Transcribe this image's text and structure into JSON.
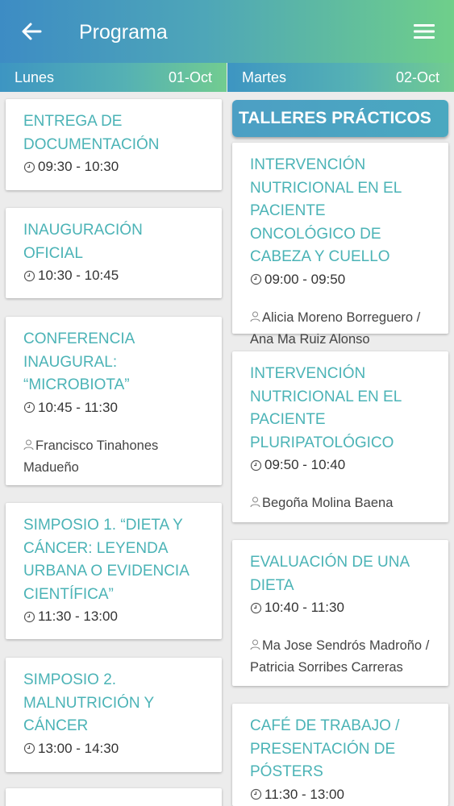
{
  "appbar": {
    "title": "Programa"
  },
  "days": [
    {
      "name": "Lunes",
      "date": "01-Oct",
      "events": [
        {
          "title": "ENTREGA DE DOCUMENTACIÓN",
          "time": "09:30 - 10:30",
          "speaker": ""
        },
        {
          "title": "INAUGURACIÓN OFICIAL",
          "time": "10:30 - 10:45",
          "speaker": ""
        },
        {
          "title": "CONFERENCIA INAUGURAL: “MICROBIOTA”",
          "time": "10:45 - 11:30",
          "speaker": "Francisco Tinahones Madueño"
        },
        {
          "title": "SIMPOSIO 1. “DIETA Y CÁNCER: LEYENDA URBANA O EVIDENCIA CIENTÍFICA”",
          "time": "11:30 - 13:00",
          "speaker": ""
        },
        {
          "title": "SIMPOSIO 2. MALNUTRICIÓN Y CÁNCER",
          "time": "13:00 - 14:30",
          "speaker": ""
        }
      ]
    },
    {
      "name": "Martes",
      "date": "02-Oct",
      "section": "TALLERES PRÁCTICOS",
      "events": [
        {
          "title": "INTERVENCIÓN NUTRICIONAL EN EL PACIENTE ONCOLÓGICO DE CABEZA Y CUELLO",
          "time": "09:00 - 09:50",
          "speaker": "Alicia Moreno Borreguero / Ana Ma Ruiz Alonso"
        },
        {
          "title": "INTERVENCIÓN NUTRICIONAL EN EL PACIENTE PLURIPATOLÓGICO",
          "time": "09:50 - 10:40",
          "speaker": "Begoña Molina Baena"
        },
        {
          "title": "EVALUACIÓN DE UNA DIETA",
          "time": "10:40 - 11:30",
          "speaker": "Ma Jose Sendrós Madroño / Patricia Sorribes Carreras"
        },
        {
          "title": "CAFÉ DE TRABAJO / PRESENTACIÓN DE PÓSTERS",
          "time": "11:30 - 13:00",
          "speaker": ""
        }
      ]
    }
  ],
  "icons": {
    "back": "arrow-left-icon",
    "menu": "hamburger-menu-icon",
    "time": "clock-icon",
    "speaker": "person-icon"
  },
  "colors": {
    "event_title": "#4bb3b6",
    "section_bg": "#4c9fc4"
  }
}
